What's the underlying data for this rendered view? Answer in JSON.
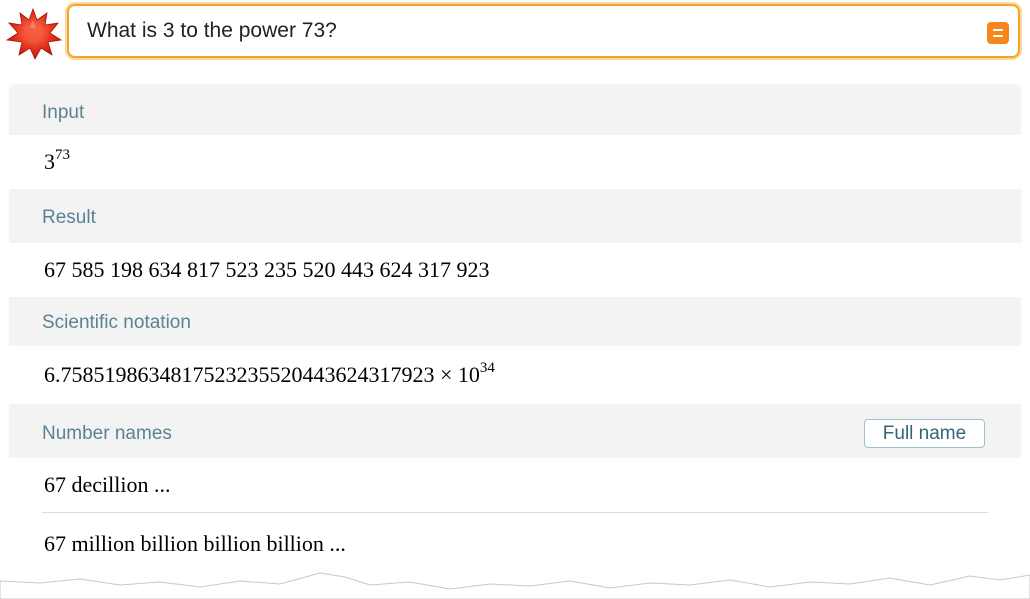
{
  "search": {
    "query": "What is 3 to the power 73?"
  },
  "colors": {
    "accent": "#f4a52a",
    "math_button": "#f7861c",
    "pod_header_text": "#5b8293",
    "pod_background": "#f3f3f3"
  },
  "pods": {
    "input": {
      "title": "Input",
      "base": "3",
      "exponent": "73"
    },
    "result": {
      "title": "Result",
      "value": "67 585 198 634 817 523 235 520 443 624 317 923"
    },
    "scientific": {
      "title": "Scientific notation",
      "mantissa": "6.7585198634817523235520443624317923 × 10",
      "exponent": "34"
    },
    "number_names": {
      "title": "Number names",
      "button_label": "Full name",
      "short_name": "67 decillion ...",
      "long_name": "67 million billion billion billion ..."
    }
  },
  "icons": {
    "logo": "wolfram-alpha-logo-icon",
    "math_input": "math-input-icon"
  }
}
